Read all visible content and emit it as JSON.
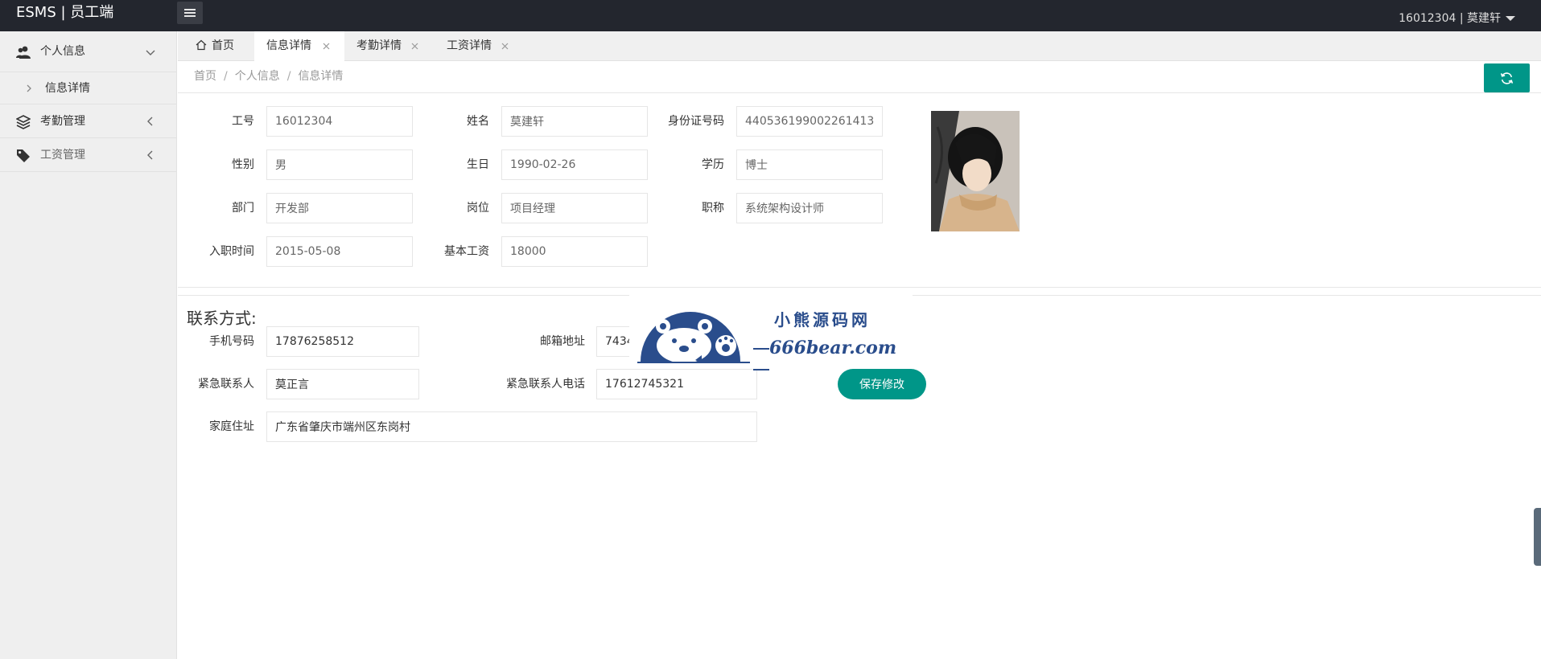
{
  "header": {
    "logo": "ESMS | 员工端",
    "user": "16012304 | 莫建轩"
  },
  "sidebar": {
    "groups": [
      {
        "label": "个人信息",
        "expanded": true,
        "sub": [
          {
            "label": "信息详情"
          }
        ]
      },
      {
        "label": "考勤管理",
        "expanded": false
      },
      {
        "label": "工资管理",
        "expanded": false
      }
    ]
  },
  "tabs": [
    {
      "label": "首页",
      "closable": false
    },
    {
      "label": "信息详情",
      "closable": true,
      "active": true
    },
    {
      "label": "考勤详情",
      "closable": true
    },
    {
      "label": "工资详情",
      "closable": true
    }
  ],
  "breadcrumb": [
    "首页",
    "个人信息",
    "信息详情"
  ],
  "info": {
    "emp_no": {
      "label": "工号",
      "value": "16012304"
    },
    "name": {
      "label": "姓名",
      "value": "莫建轩"
    },
    "id_card": {
      "label": "身份证号码",
      "value": "440536199002261413"
    },
    "gender": {
      "label": "性别",
      "value": "男"
    },
    "birthday": {
      "label": "生日",
      "value": "1990-02-26"
    },
    "education": {
      "label": "学历",
      "value": "博士"
    },
    "department": {
      "label": "部门",
      "value": "开发部"
    },
    "position": {
      "label": "岗位",
      "value": "项目经理"
    },
    "title": {
      "label": "职称",
      "value": "系统架构设计师"
    },
    "hire_date": {
      "label": "入职时间",
      "value": "2015-05-08"
    },
    "salary": {
      "label": "基本工资",
      "value": "18000"
    }
  },
  "contact": {
    "title": "联系方式:",
    "phone": {
      "label": "手机号码",
      "value": "17876258512"
    },
    "email": {
      "label": "邮箱地址",
      "value": "7434"
    },
    "emergency_name": {
      "label": "紧急联系人",
      "value": "莫正言"
    },
    "emergency_phone": {
      "label": "紧急联系人电话",
      "value": "17612745321"
    },
    "address": {
      "label": "家庭住址",
      "value": "广东省肇庆市端州区东岗村"
    },
    "save_label": "保存修改"
  },
  "watermark": {
    "line1": "小熊源码网",
    "line2": "666bear.com"
  },
  "colors": {
    "header": "#23262e",
    "accent": "#009688",
    "watermark": "#2a4d8c"
  }
}
